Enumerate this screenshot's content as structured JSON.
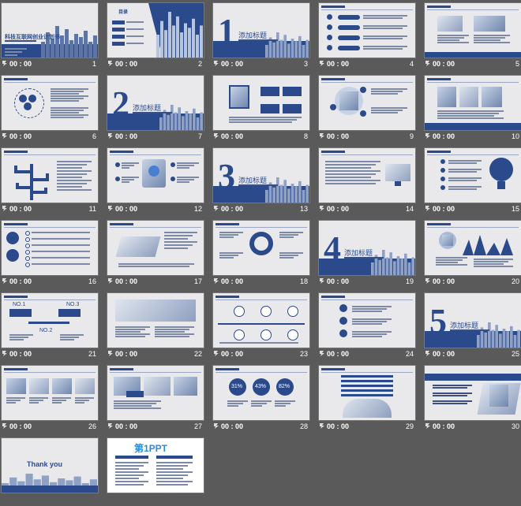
{
  "slides": [
    {
      "num": "1",
      "time": "00 : 00",
      "title": "科技互联网创业计划书"
    },
    {
      "num": "2",
      "time": "00 : 00",
      "title": "目录"
    },
    {
      "num": "3",
      "time": "00 : 00",
      "big": "1",
      "title": "添加标题"
    },
    {
      "num": "4",
      "time": "00 : 00"
    },
    {
      "num": "5",
      "time": "00 : 00"
    },
    {
      "num": "6",
      "time": "00 : 00"
    },
    {
      "num": "7",
      "time": "00 : 00",
      "big": "2",
      "title": "添加标题"
    },
    {
      "num": "8",
      "time": "00 : 00"
    },
    {
      "num": "9",
      "time": "00 : 00"
    },
    {
      "num": "10",
      "time": "00 : 00"
    },
    {
      "num": "11",
      "time": "00 : 00"
    },
    {
      "num": "12",
      "time": "00 : 00"
    },
    {
      "num": "13",
      "time": "00 : 00",
      "big": "3",
      "title": "添加标题"
    },
    {
      "num": "14",
      "time": "00 : 00"
    },
    {
      "num": "15",
      "time": "00 : 00"
    },
    {
      "num": "16",
      "time": "00 : 00"
    },
    {
      "num": "17",
      "time": "00 : 00"
    },
    {
      "num": "18",
      "time": "00 : 00"
    },
    {
      "num": "19",
      "time": "00 : 00",
      "big": "4",
      "title": "添加标题"
    },
    {
      "num": "20",
      "time": "00 : 00"
    },
    {
      "num": "21",
      "time": "00 : 00",
      "labels": [
        "NO.1",
        "NO.3",
        "NO.2"
      ]
    },
    {
      "num": "22",
      "time": "00 : 00"
    },
    {
      "num": "23",
      "time": "00 : 00"
    },
    {
      "num": "24",
      "time": "00 : 00"
    },
    {
      "num": "25",
      "time": "00 : 00",
      "big": "5",
      "title": "添加标题"
    },
    {
      "num": "26",
      "time": "00 : 00"
    },
    {
      "num": "27",
      "time": "00 : 00"
    },
    {
      "num": "28",
      "time": "00 : 00",
      "labels": [
        "31%",
        "43%",
        "82%"
      ]
    },
    {
      "num": "29",
      "time": "00 : 00"
    },
    {
      "num": "30",
      "time": "00 : 00"
    },
    {
      "num": "",
      "time": "",
      "title": "Thank you"
    },
    {
      "num": "",
      "time": "",
      "title": "第1PPT"
    }
  ],
  "colors": {
    "background": "#5a5a5a",
    "accent": "#2b4a8b",
    "slide": "#e9e9ec"
  }
}
